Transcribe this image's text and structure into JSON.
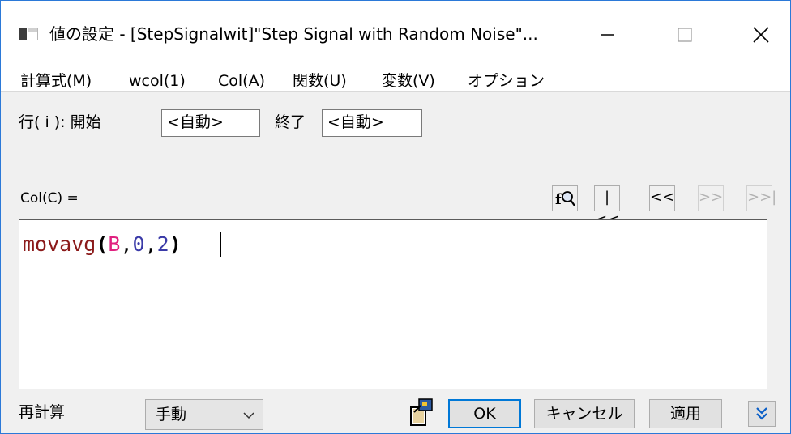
{
  "window": {
    "title": "値の設定 - [StepSignalwit]\"Step Signal with Random Noise\"...",
    "controls": {
      "minimize_icon": "minimize-icon",
      "maximize_icon": "maximize-icon",
      "close_icon": "close-icon"
    }
  },
  "menu": {
    "items": [
      "計算式(M)",
      "wcol(1)",
      "Col(A)",
      "関数(U)",
      "変数(V)",
      "オプション"
    ]
  },
  "row_range": {
    "label": "行( i ): 開始",
    "start_value": "<自動>",
    "end_label": "終了",
    "end_value": "<自動>"
  },
  "formula": {
    "label": "Col(C) =",
    "tokens": [
      {
        "text": "movavg",
        "color": "#8b1a1a"
      },
      {
        "text": "(",
        "color": "#000000",
        "bold": true
      },
      {
        "text": "B",
        "color": "#e0207f"
      },
      {
        "text": ",",
        "color": "#000000"
      },
      {
        "text": "0",
        "color": "#3a3aa8"
      },
      {
        "text": ",",
        "color": "#000000"
      },
      {
        "text": "2",
        "color": "#3a3aa8"
      },
      {
        "text": ")",
        "color": "#000000",
        "bold": true
      }
    ]
  },
  "nav_buttons": {
    "first": "|<<",
    "prev": "<<",
    "next": ">>",
    "last": ">>|"
  },
  "footer": {
    "recalc_label": "再計算",
    "recalc_value": "手動",
    "ok_label": "OK",
    "cancel_label": "キャンセル",
    "apply_label": "適用"
  },
  "colors": {
    "accent": "#0078d7",
    "window_border": "#2b79d8"
  }
}
